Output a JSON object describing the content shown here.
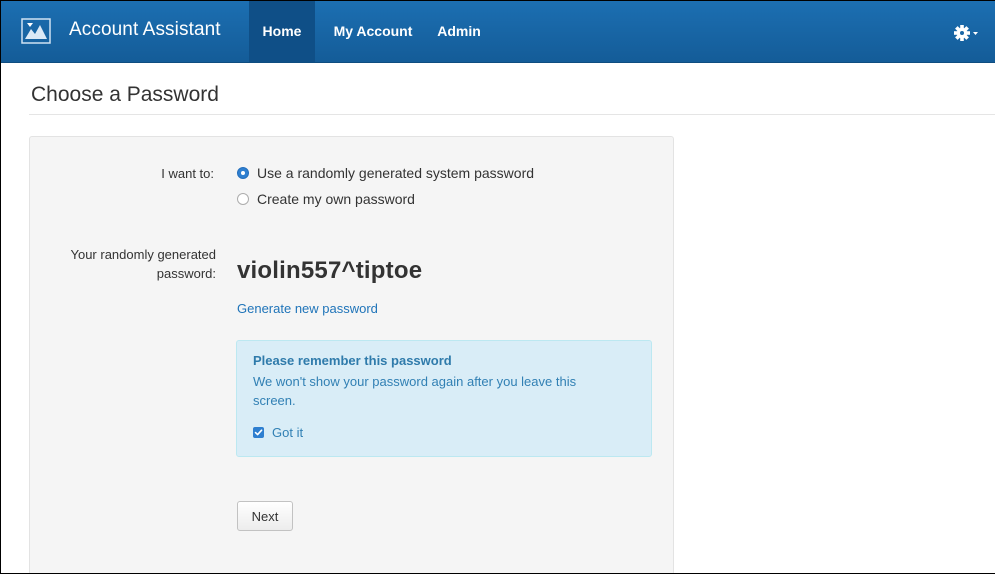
{
  "navbar": {
    "brand": "Account Assistant",
    "items": [
      {
        "label": "Home",
        "active": true
      },
      {
        "label": "My Account",
        "active": false
      },
      {
        "label": "Admin",
        "active": false
      }
    ],
    "settings_icon": "gear-icon",
    "logo_icon": "logo-icon",
    "colors": {
      "bar": "#1c6fb2",
      "active_item": "#0f4f87"
    }
  },
  "page": {
    "title": "Choose a Password"
  },
  "form": {
    "want_label": "I want to:",
    "options": [
      {
        "label": "Use a randomly generated system password",
        "selected": true
      },
      {
        "label": "Create my own password",
        "selected": false
      }
    ],
    "generated_label": "Your randomly generated password:",
    "password": "violin557^tiptoe",
    "generate_link": "Generate new password",
    "alert": {
      "title": "Please remember this password",
      "body": "We won't show your password again after you leave this screen.",
      "checkbox_label": "Got it",
      "checkbox_checked": true,
      "colors": {
        "background": "#d9edf7",
        "text": "#3180b4"
      }
    },
    "next_button": "Next"
  }
}
